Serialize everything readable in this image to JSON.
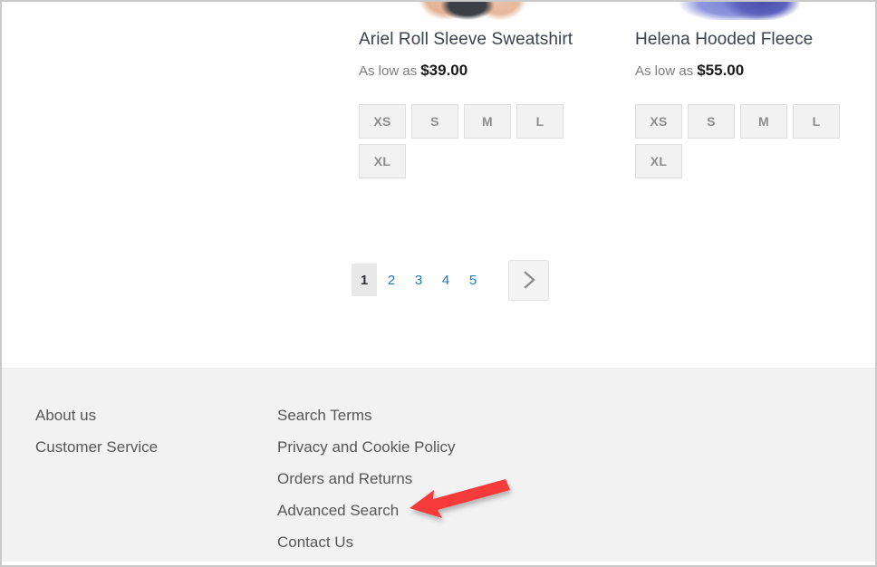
{
  "page": {
    "background_color": "#ffffff",
    "border_color": "#c9c9c9"
  },
  "products": [
    {
      "name": "Ariel Roll Sleeve Sweatshirt",
      "price_label": "As low as",
      "price": "$39.00",
      "sizes": [
        "XS",
        "S",
        "M",
        "L",
        "XL"
      ]
    },
    {
      "name": "Helena Hooded Fleece",
      "price_label": "As low as",
      "price": "$55.00",
      "sizes": [
        "XS",
        "S",
        "M",
        "L",
        "XL"
      ]
    }
  ],
  "pagination": {
    "pages": [
      {
        "label": "1",
        "current": true
      },
      {
        "label": "2",
        "current": false
      },
      {
        "label": "3",
        "current": false
      },
      {
        "label": "4",
        "current": false
      },
      {
        "label": "5",
        "current": false
      }
    ],
    "next_icon": "chevron-right-icon",
    "current_page": 1,
    "link_color": "#1979c3",
    "current_background": "#e8e8e8"
  },
  "footer": {
    "background_color": "#f2f2f2",
    "link_color": "#575757",
    "columns": [
      {
        "name": "left",
        "links": [
          "About us",
          "Customer Service"
        ]
      },
      {
        "name": "right",
        "links": [
          "Search Terms",
          "Privacy and Cookie Policy",
          "Orders and Returns",
          "Advanced Search",
          "Contact Us"
        ]
      }
    ]
  },
  "annotation": {
    "type": "arrow",
    "color": "#f73b3b",
    "points_to": "Advanced Search",
    "direction": "left-down"
  }
}
